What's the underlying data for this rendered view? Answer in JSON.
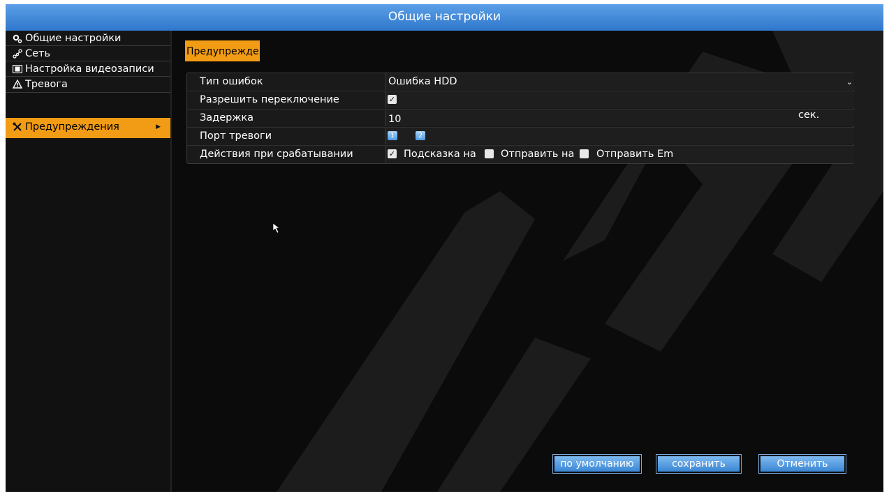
{
  "window": {
    "title": "Общие настройки"
  },
  "sidebar": {
    "items": [
      {
        "label": "Общие настройки",
        "icon": "gears-icon"
      },
      {
        "label": "Сеть",
        "icon": "network-icon"
      },
      {
        "label": "Настройка видеозаписи",
        "icon": "film-icon"
      },
      {
        "label": "Тревога",
        "icon": "warning-triangle-icon"
      },
      {
        "label": "Предупреждения",
        "icon": "tools-icon",
        "active": true
      }
    ]
  },
  "tab": {
    "label": "Предупрежде"
  },
  "form": {
    "error_type": {
      "label": "Тип ошибок",
      "value": "Ошибка HDD"
    },
    "allow_switch": {
      "label": "Разрешить переключение",
      "checked": true
    },
    "delay": {
      "label": "Задержка",
      "value": "10",
      "unit": "сек."
    },
    "alarm_port": {
      "label": "Порт тревоги",
      "ports": [
        "1",
        "2"
      ]
    },
    "actions": {
      "label": "Действия при срабатывании",
      "options": [
        {
          "label": "Подсказка на",
          "checked": true
        },
        {
          "label": "Отправить на",
          "checked": false
        },
        {
          "label": "Отправить Em",
          "checked": false
        }
      ]
    }
  },
  "buttons": {
    "default": "по умолчанию",
    "save": "сохранить",
    "cancel": "Отменить"
  },
  "colors": {
    "title_bar": "#3f8ad9",
    "accent_orange": "#f29b14",
    "button_blue": "#5aa0e6",
    "background": "#0b0b0b"
  }
}
